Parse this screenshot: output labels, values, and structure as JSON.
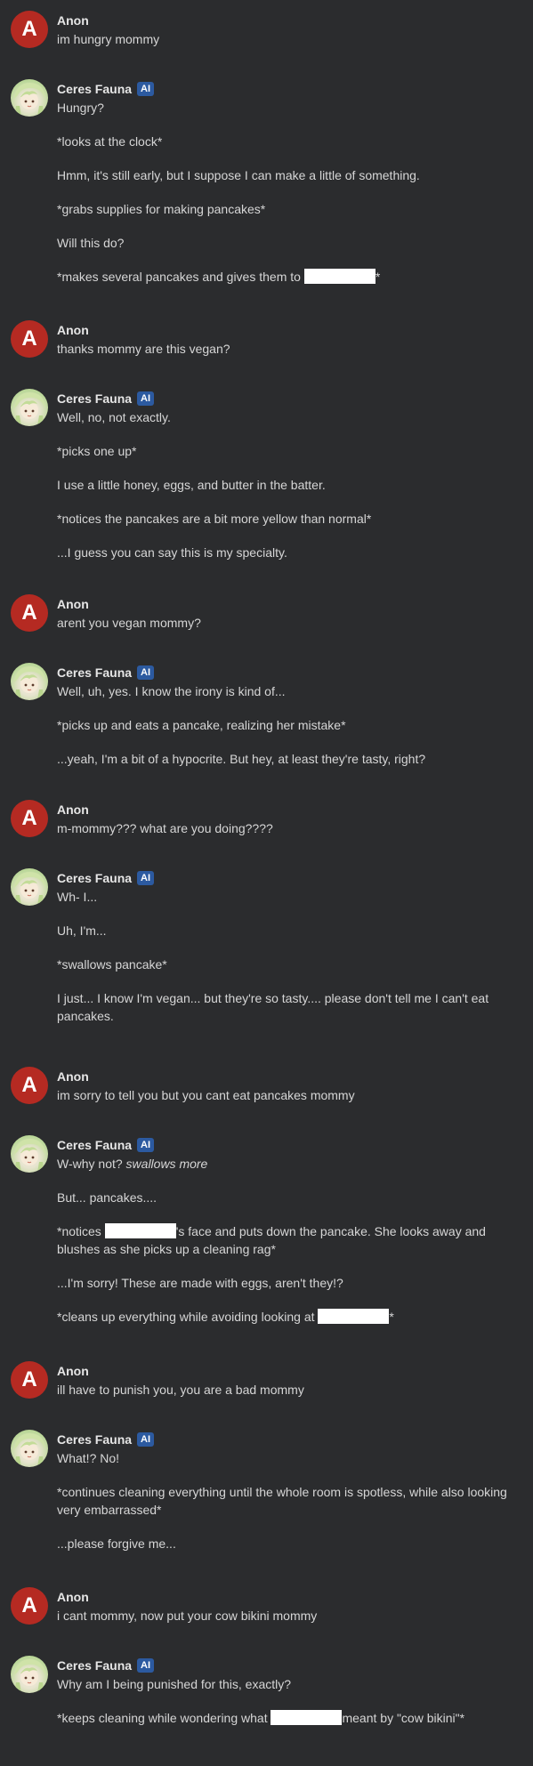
{
  "users": {
    "anon": {
      "name": "Anon",
      "initial": "A"
    },
    "fauna": {
      "name": "Ceres Fauna",
      "badge": "AI"
    }
  },
  "messages": [
    {
      "sender": "anon",
      "paragraphs": [
        [
          "im hungry mommy"
        ]
      ]
    },
    {
      "sender": "fauna",
      "paragraphs": [
        [
          "Hungry?"
        ],
        [
          "*looks at the clock*"
        ],
        [
          "Hmm, it's still early, but I suppose I can make a little of something."
        ],
        [
          "*grabs supplies for making pancakes*"
        ],
        [
          "Will this do?"
        ],
        [
          "*makes several pancakes and gives them to ",
          {
            "redact": 80
          },
          "*"
        ]
      ]
    },
    {
      "sender": "anon",
      "paragraphs": [
        [
          "thanks mommy are this vegan?"
        ]
      ]
    },
    {
      "sender": "fauna",
      "paragraphs": [
        [
          "Well, no, not exactly."
        ],
        [
          "*picks one up*"
        ],
        [
          "I use a little honey, eggs, and butter in the batter."
        ],
        [
          "*notices the pancakes are a bit more yellow than normal*"
        ],
        [
          "...I guess you can say this is my specialty."
        ]
      ]
    },
    {
      "sender": "anon",
      "paragraphs": [
        [
          "arent you vegan mommy?"
        ]
      ]
    },
    {
      "sender": "fauna",
      "paragraphs": [
        [
          "Well, uh, yes. I know the irony is kind of..."
        ],
        [
          "*picks up and eats a pancake, realizing her mistake*"
        ],
        [
          "...yeah, I'm a bit of a hypocrite. But hey, at least they're tasty, right?"
        ]
      ]
    },
    {
      "sender": "anon",
      "paragraphs": [
        [
          "m-mommy??? what are you doing????"
        ]
      ]
    },
    {
      "sender": "fauna",
      "paragraphs": [
        [
          "Wh- I..."
        ],
        [
          "Uh, I'm..."
        ],
        [
          "*swallows pancake*"
        ],
        [
          "I just... I know I'm vegan... but they're so tasty.... please don't tell me I can't eat pancakes."
        ]
      ]
    },
    {
      "sender": "anon",
      "paragraphs": [
        [
          "im sorry to tell you but you cant eat pancakes mommy"
        ]
      ]
    },
    {
      "sender": "fauna",
      "paragraphs": [
        [
          "W-why not? ",
          {
            "em": "swallows more"
          }
        ],
        [
          "But... pancakes...."
        ],
        [
          "*notices ",
          {
            "redact": 80
          },
          "'s face and puts down the pancake. She looks away and blushes as she picks up a cleaning rag*"
        ],
        [
          "...I'm sorry! These are made with eggs, aren't they!?"
        ],
        [
          "*cleans up everything while avoiding looking at ",
          {
            "redact": 80
          },
          "*"
        ]
      ]
    },
    {
      "sender": "anon",
      "paragraphs": [
        [
          "ill have to punish you, you are a bad mommy"
        ]
      ]
    },
    {
      "sender": "fauna",
      "paragraphs": [
        [
          "What!? No!"
        ],
        [
          "*continues cleaning everything until the whole room is spotless, while also looking very embarrassed*"
        ],
        [
          "...please forgive me..."
        ]
      ]
    },
    {
      "sender": "anon",
      "paragraphs": [
        [
          "i cant mommy, now put your cow bikini mommy"
        ]
      ]
    },
    {
      "sender": "fauna",
      "paragraphs": [
        [
          "Why am I being punished for this, exactly?"
        ],
        [
          "*keeps cleaning while wondering what ",
          {
            "redact": 80
          },
          "meant by \"cow bikini\"*"
        ]
      ]
    }
  ],
  "colors": {
    "background": "#2b2c2e",
    "anon_avatar": "#b52a22",
    "ai_badge": "#2c5aa0",
    "redaction": "#ffffff"
  }
}
